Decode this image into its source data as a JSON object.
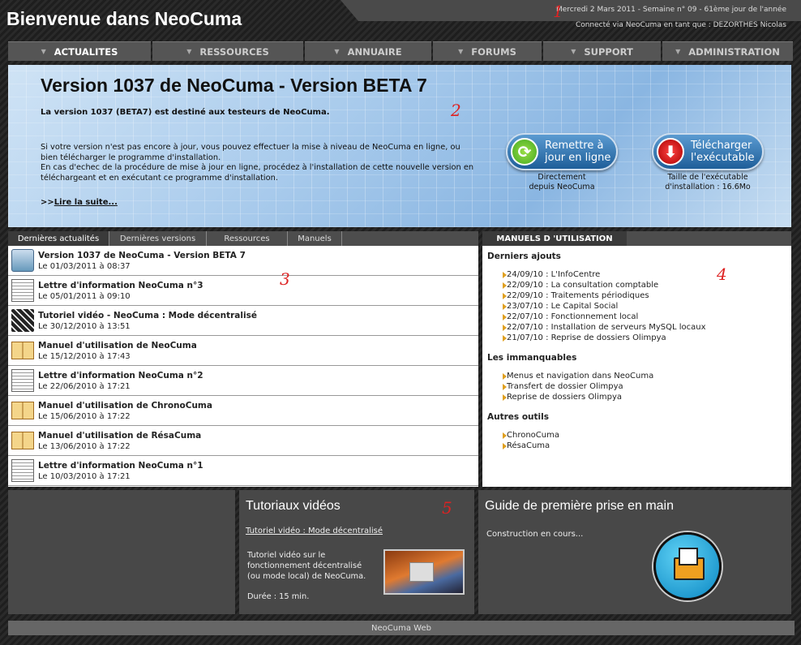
{
  "header": {
    "title": "Bienvenue dans NeoCuma",
    "date_line": "Mercredi 2 Mars 2011 - Semaine n° 09 - 61ème jour de l'année",
    "user_line": "Connecté via NeoCuma en tant que : DEZORTHES Nicolas"
  },
  "markers": [
    "1",
    "2",
    "3",
    "4",
    "5"
  ],
  "nav": [
    "ACTUALITES",
    "RESSOURCES",
    "ANNUAIRE",
    "FORUMS",
    "SUPPORT",
    "ADMINISTRATION"
  ],
  "hero": {
    "title": "Version 1037 de NeoCuma - Version BETA 7",
    "subtitle": "La version 1037 (BETA7) est destiné aux testeurs de NeoCuma.",
    "body1": "Si votre version n'est pas encore à jour, vous pouvez effectuer la mise à niveau de NeoCuma en ligne, ou bien télécharger le programme d'installation.",
    "body2": "En cas d'echec de la procédure de mise à jour en ligne, procédez à l'installation de cette nouvelle version en téléchargeant et en exécutant ce programme d'installation.",
    "more_prefix": ">>",
    "more_link": "Lire la suite...",
    "btn_update_l1": "Remettre à",
    "btn_update_l2": "jour en ligne",
    "btn_update_cap1": "Directement",
    "btn_update_cap2": "depuis NeoCuma",
    "btn_dl_l1": "Télécharger",
    "btn_dl_l2": "l'exécutable",
    "btn_dl_cap1": "Taille de l'exécutable",
    "btn_dl_cap2": "d'installation : 16.6Mo"
  },
  "tabs": [
    "Dernières actualités",
    "Dernières versions",
    "Ressources",
    "Manuels"
  ],
  "news": [
    {
      "title": "Version 1037 de NeoCuma - Version BETA 7",
      "date": "Le 01/03/2011 à 08:37",
      "icon": "install-icon"
    },
    {
      "title": "Lettre d'information NeoCuma n°3",
      "date": "Le 05/01/2011 à 09:10",
      "icon": "newsletter-icon"
    },
    {
      "title": "Tutoriel vidéo - NeoCuma : Mode décentralisé",
      "date": "Le 30/12/2010 à 13:51",
      "icon": "film-icon"
    },
    {
      "title": "Manuel d'utilisation de NeoCuma",
      "date": "Le 15/12/2010 à 17:43",
      "icon": "book-icon"
    },
    {
      "title": "Lettre d'information NeoCuma n°2",
      "date": "Le 22/06/2010 à 17:21",
      "icon": "newsletter-icon"
    },
    {
      "title": "Manuel d'utilisation de ChronoCuma",
      "date": "Le 15/06/2010 à 17:22",
      "icon": "book-icon"
    },
    {
      "title": "Manuel d'utilisation de RésaCuma",
      "date": "Le 13/06/2010 à 17:22",
      "icon": "book-icon"
    },
    {
      "title": "Lettre d'information NeoCuma n°1",
      "date": "Le 10/03/2010 à 17:21",
      "icon": "newsletter-icon"
    }
  ],
  "manuals": {
    "header": "MANUELS D 'UTILISATION",
    "sec1": "Derniers ajouts",
    "recent": [
      "24/09/10 : L'InfoCentre",
      "22/09/10 : La consultation comptable",
      "22/09/10 : Traitements périodiques",
      "23/07/10 : Le Capital Social",
      "22/07/10 : Fonctionnement local",
      "22/07/10 : Installation de serveurs MySQL locaux",
      "21/07/10 : Reprise de dossiers Olimpya"
    ],
    "sec2": "Les immanquables",
    "must": [
      "Menus et navigation dans NeoCuma",
      "Transfert de dossier Olimpya",
      "Reprise de dossiers Olimpya"
    ],
    "sec3": "Autres outils",
    "tools": [
      "ChronoCuma",
      "RésaCuma"
    ]
  },
  "tutorials": {
    "title": "Tutoriaux vidéos",
    "link": "Tutoriel vidéo : Mode décentralisé",
    "desc": "Tutoriel vidéo sur le fonctionnement décentralisé (ou mode local) de NeoCuma.",
    "duration": "Durée : 15 min."
  },
  "guide": {
    "title": "Guide de première prise en main",
    "text": "Construction en cours..."
  },
  "footer": "NeoCuma Web"
}
